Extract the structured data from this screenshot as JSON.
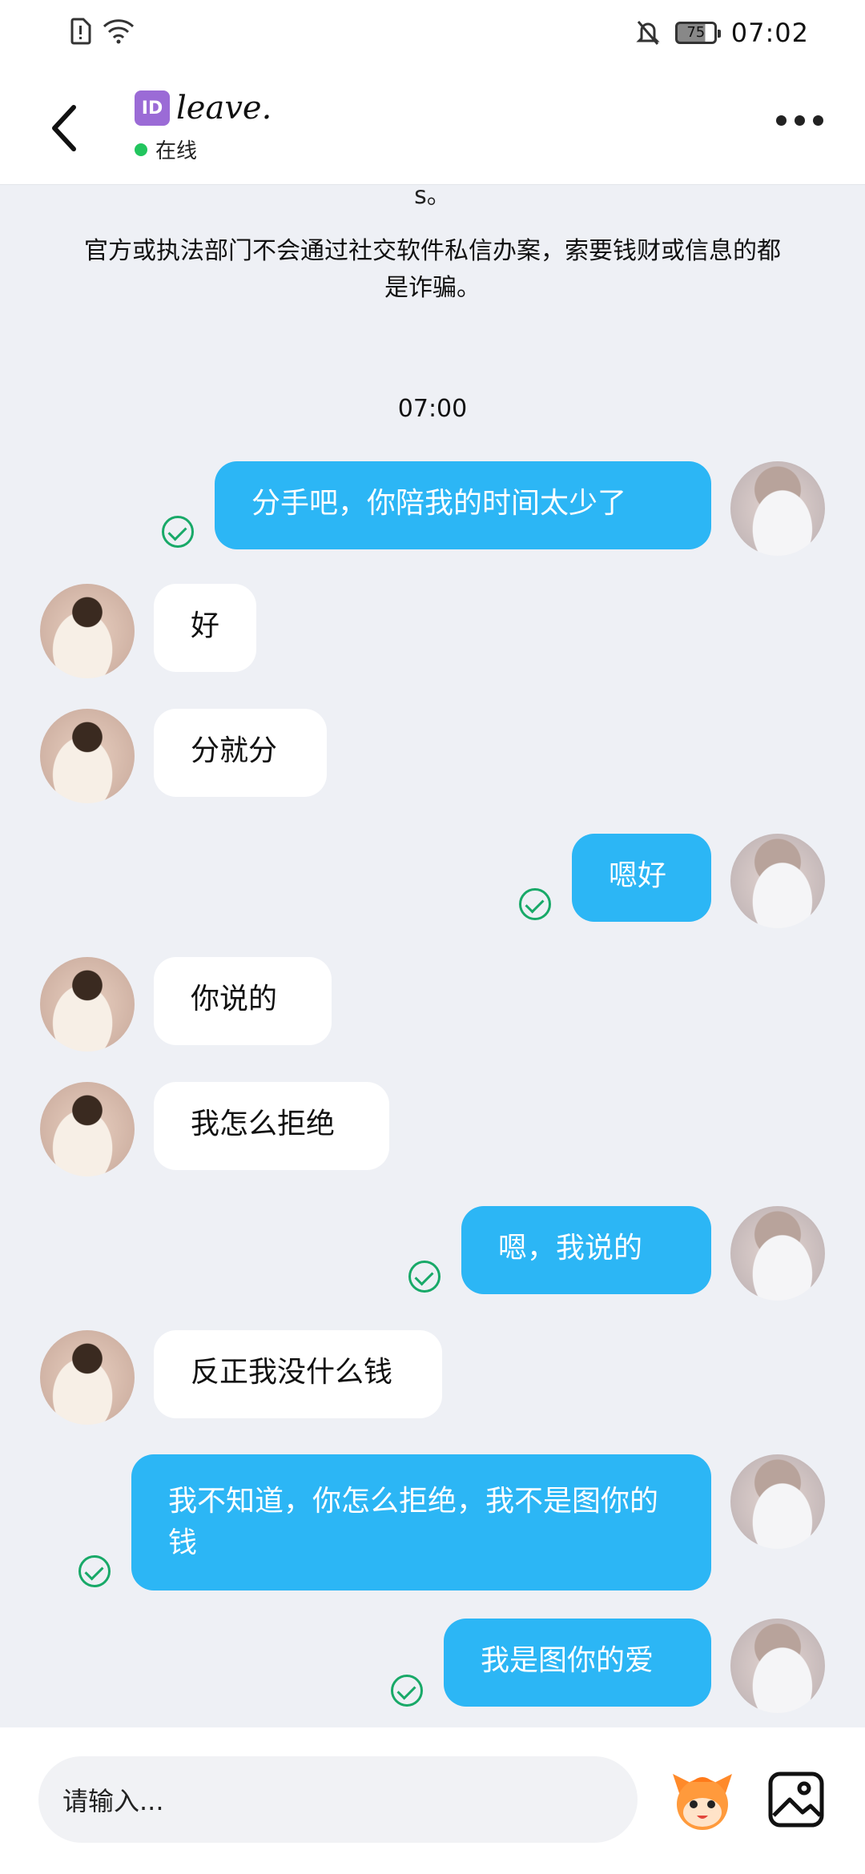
{
  "status_bar": {
    "time": "07:02",
    "battery": "75",
    "icons": [
      "sim-alert-icon",
      "wifi-icon",
      "bell-off-icon",
      "battery-icon"
    ]
  },
  "header": {
    "badge": "ID",
    "title": "leave.",
    "status": "在线",
    "status_color": "#22c55e",
    "icons": [
      "back-arrow-icon",
      "more-dots-icon"
    ]
  },
  "chat": {
    "clipped_text": "s。",
    "notice": "官方或执法部门不会通过社交软件私信办案，索要钱财或信息的都是诈骗。",
    "timestamp": "07:00",
    "messages": [
      {
        "from": "self",
        "text": "分手吧，你陪我的时间太少了"
      },
      {
        "from": "other",
        "text": "好"
      },
      {
        "from": "other",
        "text": "分就分"
      },
      {
        "from": "self",
        "text": "嗯好"
      },
      {
        "from": "other",
        "text": "你说的"
      },
      {
        "from": "other",
        "text": "我怎么拒绝"
      },
      {
        "from": "self",
        "text": "嗯，我说的"
      },
      {
        "from": "other",
        "text": "反正我没什么钱"
      },
      {
        "from": "self",
        "text": "我不知道，你怎么拒绝，我不是图你的钱"
      },
      {
        "from": "self",
        "text": "我是图你的爱"
      }
    ],
    "colors": {
      "self_bubble": "#2cb6f5",
      "other_bubble": "#ffffff",
      "read_check": "#18a968"
    }
  },
  "input": {
    "placeholder": "请输入...",
    "icons": [
      "mascot-emoji-icon",
      "image-picker-icon"
    ]
  }
}
